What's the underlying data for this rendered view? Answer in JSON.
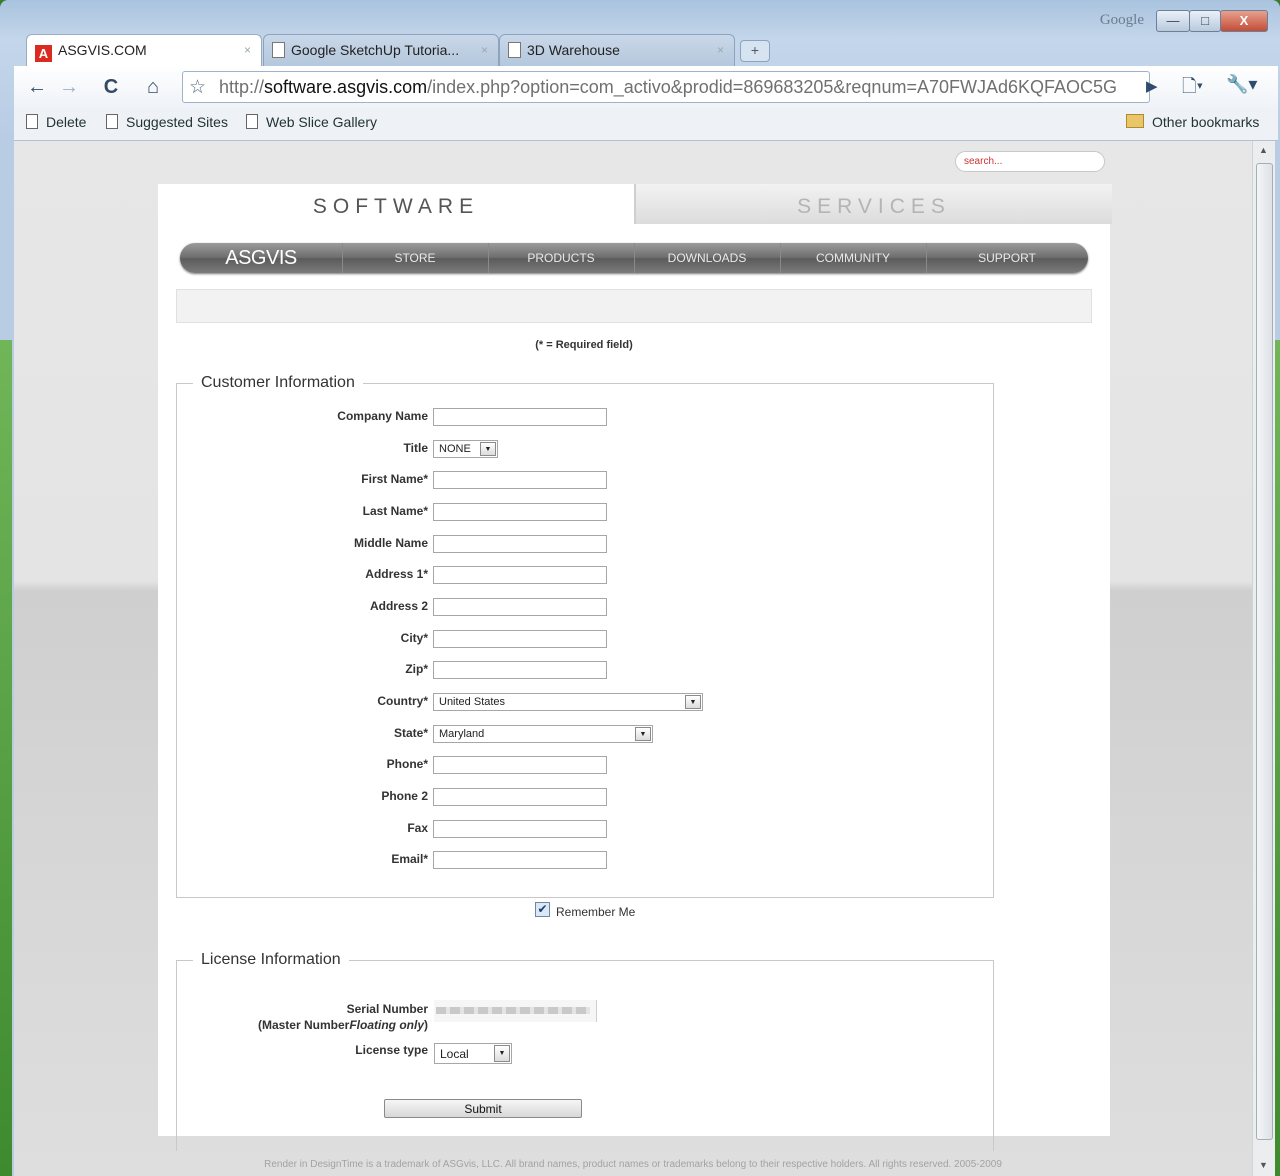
{
  "window": {
    "google_label": "Google",
    "min_glyph": "—",
    "max_glyph": "□",
    "close_glyph": "X",
    "new_tab_glyph": "+",
    "tab_close_glyph": "×"
  },
  "tabs": [
    {
      "title": "ASGVIS.COM",
      "favicon": "A",
      "active": true
    },
    {
      "title": "Google SketchUp Tutoria...",
      "active": false
    },
    {
      "title": "3D Warehouse",
      "active": false
    }
  ],
  "toolbar": {
    "back_glyph": "←",
    "forward_glyph": "→",
    "reload_glyph": "C",
    "home_glyph": "⌂",
    "star_glyph": "☆",
    "url_scheme": "http://",
    "url_host": "software.asgvis.com",
    "url_rest": "/index.php?option=com_activo&prodid=869683205&reqnum=A70FWJAd6KQFAOC5G",
    "go_glyph": "▶",
    "page_menu_glyph": "🗋▾",
    "wrench_glyph": "🔧▾"
  },
  "bookmarks": {
    "items": [
      "Delete",
      "Suggested Sites",
      "Web Slice Gallery"
    ],
    "other": "Other bookmarks"
  },
  "site": {
    "search_placeholder": "search...",
    "tab_software": "SOFTWARE",
    "tab_services": "SERVICES",
    "nav": {
      "brand": "ASGVIS",
      "items": [
        "STORE",
        "PRODUCTS",
        "DOWNLOADS",
        "COMMUNITY",
        "SUPPORT"
      ]
    },
    "required_note": "(* = Required field)"
  },
  "customer": {
    "legend": "Customer Information",
    "fields": {
      "company": "Company Name",
      "title": "Title",
      "first": "First Name*",
      "last": "Last Name*",
      "middle": "Middle Name",
      "address1": "Address 1*",
      "address2": "Address 2",
      "city": "City*",
      "zip": "Zip*",
      "country": "Country*",
      "state": "State*",
      "phone": "Phone*",
      "phone2": "Phone 2",
      "fax": "Fax",
      "email": "Email*"
    },
    "title_value": "NONE",
    "country_value": "United States",
    "state_value": "Maryland",
    "remember_label": "Remember Me",
    "remember_checked": true
  },
  "license": {
    "legend": "License Information",
    "serial_label": "Serial Number",
    "serial_sub_prefix": "(Master Number",
    "serial_sub_italic": "Floating only",
    "serial_sub_suffix": ")",
    "license_type_label": "License type",
    "license_type_value": "Local",
    "submit_label": "Submit"
  },
  "footer": {
    "text": "Render in DesignTime is a trademark of ASGvis, LLC. All brand names, product names or trademarks belong to their respective holders. All rights reserved. 2005-2009"
  }
}
